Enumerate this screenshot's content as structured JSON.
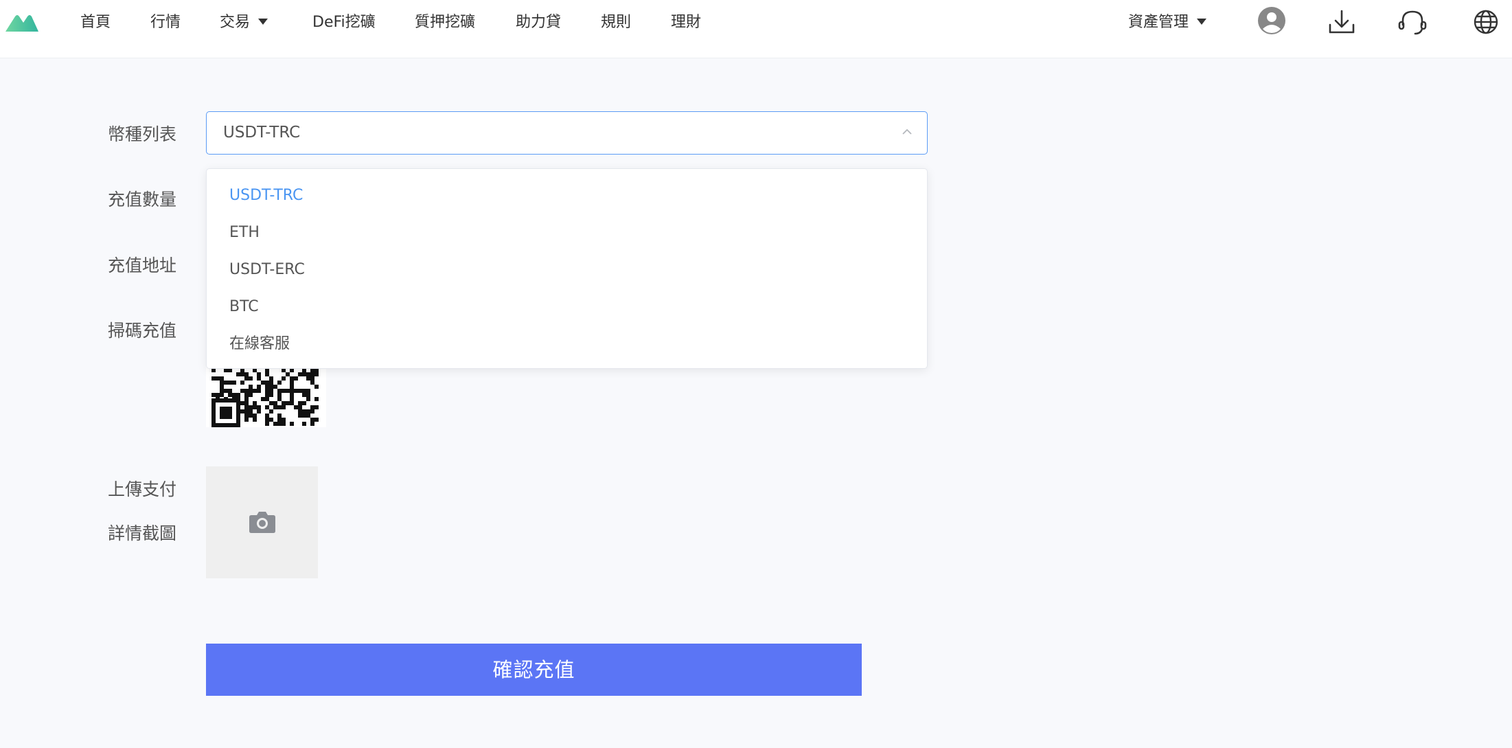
{
  "nav": {
    "items": [
      {
        "label": "首頁"
      },
      {
        "label": "行情"
      },
      {
        "label": "交易"
      },
      {
        "label": "DeFi挖礦"
      },
      {
        "label": "質押挖礦"
      },
      {
        "label": "助力貸"
      },
      {
        "label": "規則"
      },
      {
        "label": "理財"
      }
    ],
    "asset_management": "資產管理"
  },
  "form": {
    "currency_label": "幣種列表",
    "amount_label": "充值數量",
    "address_label": "充值地址",
    "scan_label": "掃碼充值",
    "upload_label_line1": "上傳支付",
    "upload_label_line2": "詳情截圖",
    "selected_currency": "USDT-TRC",
    "options": [
      "USDT-TRC",
      "ETH",
      "USDT-ERC",
      "BTC",
      "在線客服"
    ],
    "confirm_label": "確認充值"
  },
  "colors": {
    "accent": "#5b75f5",
    "selected": "#4a95f2",
    "border_focus": "#5b9bf5",
    "page_bg": "#f8f9fc"
  },
  "icons": {
    "logo": "mountain-logo",
    "trade_dropdown": "caret-down-icon",
    "asset_dropdown": "caret-down-icon",
    "user": "user-avatar-icon",
    "download": "download-icon",
    "support": "headset-icon",
    "language": "globe-icon",
    "select_arrow": "chevron-up-icon",
    "upload": "camera-icon"
  }
}
